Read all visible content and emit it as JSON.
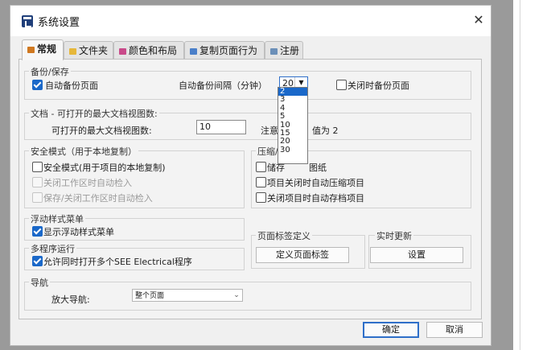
{
  "window": {
    "title": "系统设置",
    "close_glyph": "✕"
  },
  "tabs": [
    {
      "label": "常规",
      "icon": "general-icon",
      "color": "#d07820"
    },
    {
      "label": "文件夹",
      "icon": "folder-icon",
      "color": "#e6b73a"
    },
    {
      "label": "颜色和布局",
      "icon": "palette-icon",
      "color": "#c94a8a"
    },
    {
      "label": "复制页面行为",
      "icon": "copy-page-icon",
      "color": "#4a7fc9"
    },
    {
      "label": "注册",
      "icon": "register-icon",
      "color": "#6b8fb8"
    }
  ],
  "backup": {
    "title": "备份/保存",
    "auto_backup_label": "自动备份页面",
    "auto_backup_checked": true,
    "interval_label": "自动备份间隔（分钟）",
    "interval_value": "20",
    "close_backup_label": "关闭时备份页面",
    "close_backup_checked": false,
    "interval_options": [
      "2",
      "3",
      "4",
      "5",
      "10",
      "15",
      "20",
      "30"
    ]
  },
  "documents": {
    "title": "文档 - 可打开的最大文档视图数:",
    "max_label": "可打开的最大文档视图数:",
    "max_value": "10",
    "note_prefix": "注意",
    "note_suffix": "值为 2"
  },
  "safe_mode": {
    "title": "安全模式（用于本地复制）",
    "items": [
      {
        "label": "安全模式(用于项目的本地复制)",
        "checked": false,
        "enabled": true
      },
      {
        "label": "关闭工作区时自动检入",
        "checked": false,
        "enabled": false
      },
      {
        "label": "保存/关闭工作区时自动检入",
        "checked": false,
        "enabled": false
      }
    ]
  },
  "compress": {
    "title": "压缩/",
    "title_suffix": "",
    "items": [
      {
        "label": "储存",
        "label_tail": "图纸",
        "checked": false
      },
      {
        "label": "项目关闭时自动压缩项目",
        "checked": false
      },
      {
        "label": "关闭项目时自动存档项目",
        "checked": false
      }
    ]
  },
  "floating_menu": {
    "title": "浮动样式菜单",
    "show_label": "显示浮动样式菜单",
    "checked": true
  },
  "multi_run": {
    "title": "多程序运行",
    "allow_label": "允许同时打开多个SEE Electrical程序",
    "checked": true
  },
  "page_tag": {
    "title": "页面标签定义",
    "button": "定义页面标签"
  },
  "realtime": {
    "title": "实时更新",
    "button": "设置"
  },
  "navigation": {
    "title": "导航",
    "zoom_label": "放大导航:",
    "zoom_value": "整个页面"
  },
  "footer": {
    "ok": "确定",
    "cancel": "取消"
  },
  "colors": {
    "accent": "#1a68c9",
    "dialog_bg": "#f0f0f0"
  }
}
